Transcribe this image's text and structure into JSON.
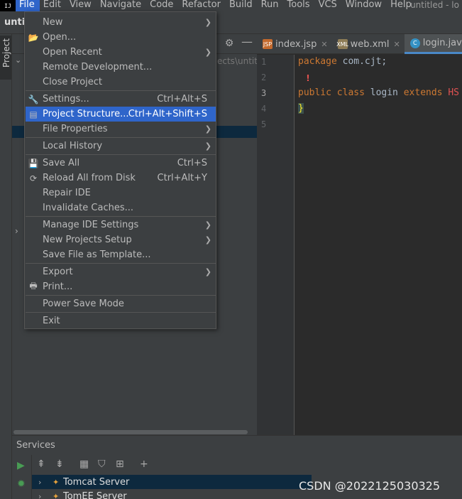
{
  "menubar": {
    "logo_text": "IJ",
    "items": [
      "File",
      "Edit",
      "View",
      "Navigate",
      "Code",
      "Refactor",
      "Build",
      "Run",
      "Tools",
      "VCS",
      "Window",
      "Help"
    ],
    "window_title": "untitled - lo"
  },
  "navbar": {
    "project_name": "untit"
  },
  "tool_stripe": {
    "project_label": "Project"
  },
  "project_panel": {
    "path_fragment": "ects\\untitle"
  },
  "editor": {
    "tabs": [
      {
        "label": "index.jsp",
        "icon": "JSP",
        "active": false
      },
      {
        "label": "web.xml",
        "icon": "XML",
        "active": false
      },
      {
        "label": "login.java",
        "icon": "C",
        "active": true
      }
    ],
    "line_numbers": [
      "1",
      "2",
      "3",
      "4",
      "5"
    ],
    "code": {
      "line1_kw": "package",
      "line1_rest": " com.cjt;",
      "line3_kw1": "public class",
      "line3_name": " login ",
      "line3_kw2": "extends",
      "line3_tail": " HS",
      "line4": "}"
    },
    "bulb_glyph": "!"
  },
  "file_menu": {
    "items": {
      "new": {
        "label": "New"
      },
      "open": {
        "label": "Open..."
      },
      "open_recent": {
        "label": "Open Recent"
      },
      "remote_dev": {
        "label": "Remote Development..."
      },
      "close_project": {
        "label": "Close Project"
      },
      "settings": {
        "label": "Settings...",
        "shortcut": "Ctrl+Alt+S"
      },
      "project_structure": {
        "label": "Project Structure...",
        "shortcut": "Ctrl+Alt+Shift+S"
      },
      "file_properties": {
        "label": "File Properties"
      },
      "local_history": {
        "label": "Local History"
      },
      "save_all": {
        "label": "Save All",
        "shortcut": "Ctrl+S"
      },
      "reload": {
        "label": "Reload All from Disk",
        "shortcut": "Ctrl+Alt+Y"
      },
      "repair_ide": {
        "label": "Repair IDE"
      },
      "invalidate_caches": {
        "label": "Invalidate Caches..."
      },
      "manage_ide_settings": {
        "label": "Manage IDE Settings"
      },
      "new_projects_setup": {
        "label": "New Projects Setup"
      },
      "save_as_template": {
        "label": "Save File as Template..."
      },
      "export": {
        "label": "Export"
      },
      "print": {
        "label": "Print..."
      },
      "power_save": {
        "label": "Power Save Mode"
      },
      "exit": {
        "label": "Exit"
      }
    }
  },
  "services": {
    "title": "Services",
    "rows": [
      "Tomcat Server",
      "TomEE Server"
    ]
  },
  "watermark": "CSDN @2022125030325",
  "colors": {
    "accent": "#2f65ca",
    "panel": "#3c3f41",
    "editor_bg": "#2b2b2b",
    "keyword": "#cc7832",
    "selection": "#0d293e"
  }
}
